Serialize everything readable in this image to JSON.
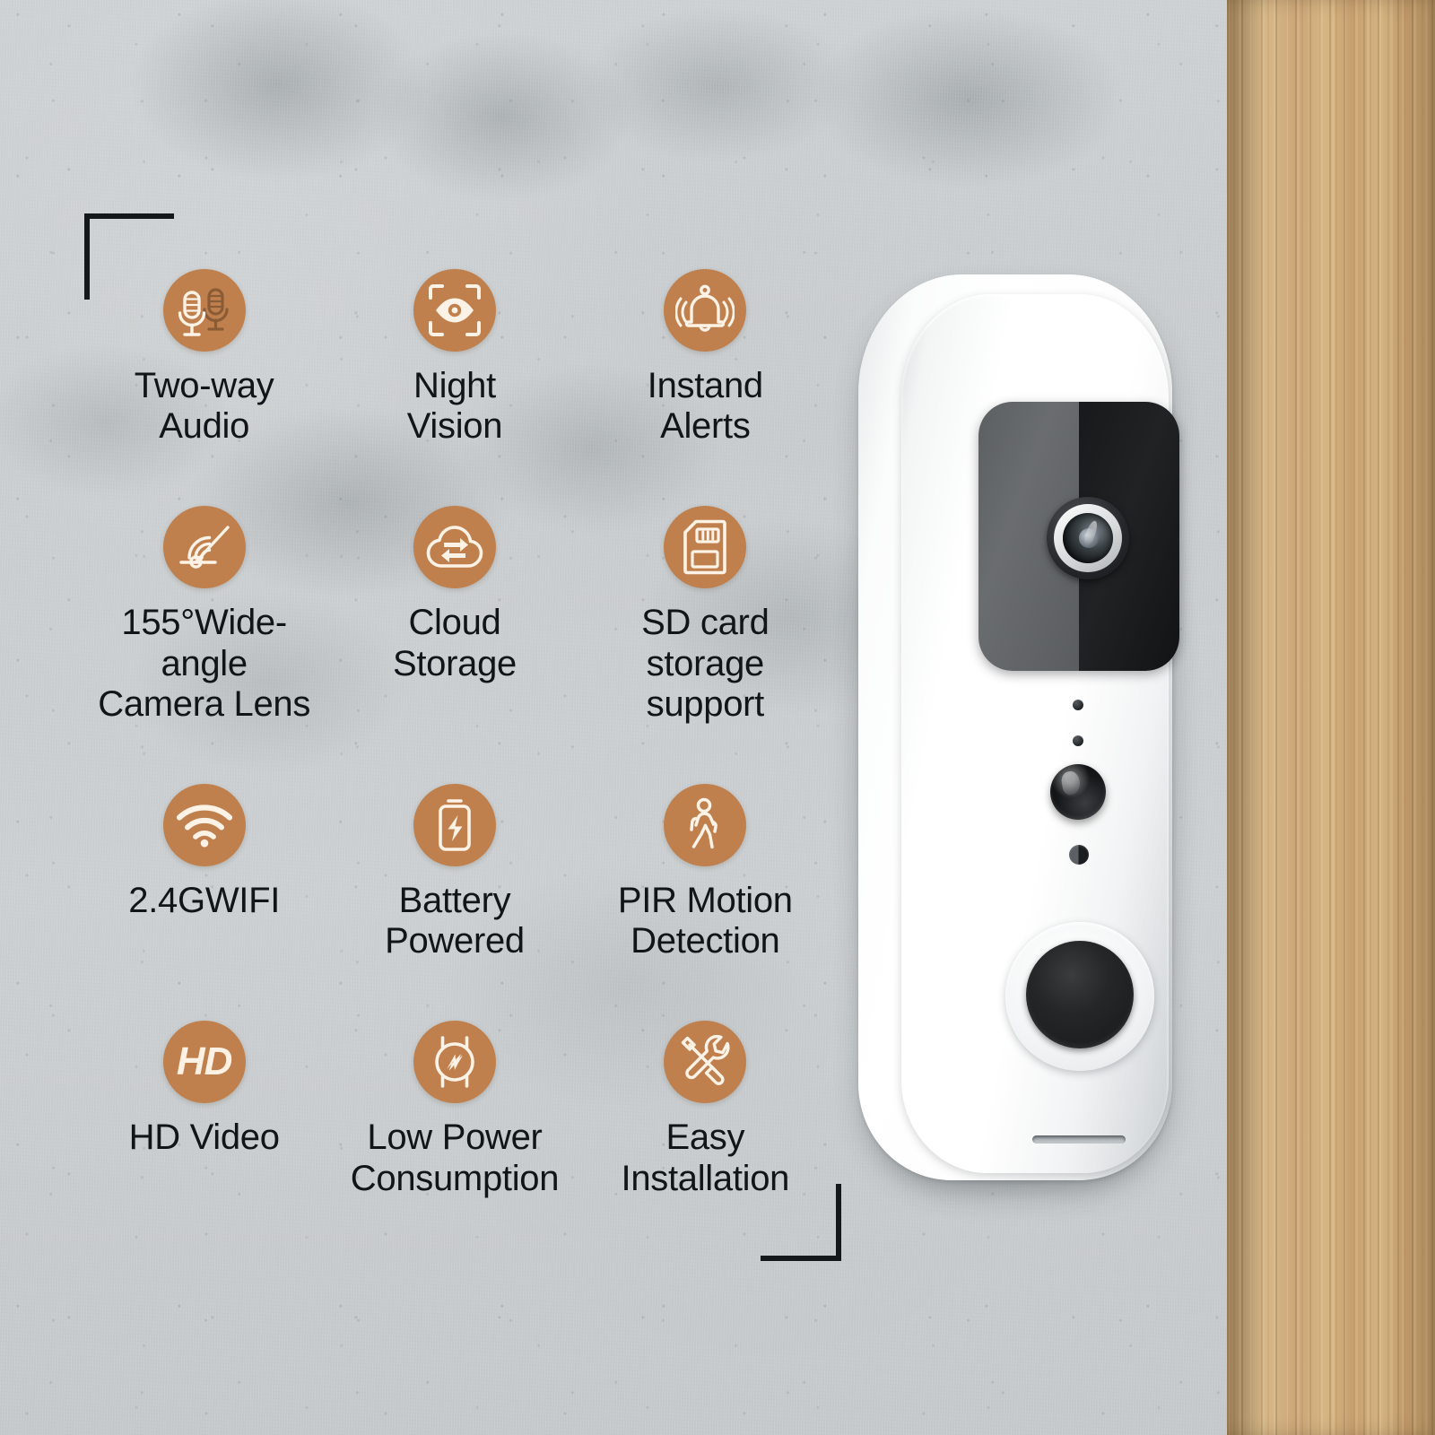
{
  "scene": {
    "title": "Smart Video Doorbell Feature Infographic",
    "background": "concrete-wall",
    "accent_color": "#c0804d",
    "text_color": "#111418",
    "wall_color": "#c9cdcf",
    "wood_color": "#cba577"
  },
  "brackets": {
    "top_left": "corner-bracket",
    "bottom_right": "corner-bracket"
  },
  "features": [
    {
      "icon": "two-way-audio-icon",
      "label": "Two-way\nAudio"
    },
    {
      "icon": "night-vision-eye-icon",
      "label": "Night\nVision"
    },
    {
      "icon": "instant-alerts-bell-icon",
      "label": "Instand\nAlerts"
    },
    {
      "icon": "wide-angle-lens-icon",
      "label": "155°Wide-angle\nCamera Lens"
    },
    {
      "icon": "cloud-storage-icon",
      "label": "Cloud\nStorage"
    },
    {
      "icon": "sd-card-icon",
      "label": "SD card\nstorage support"
    },
    {
      "icon": "wifi-icon",
      "label": "2.4GWIFI"
    },
    {
      "icon": "battery-icon",
      "label": "Battery\nPowered"
    },
    {
      "icon": "pir-motion-walking-icon",
      "label": "PIR Motion\nDetection"
    },
    {
      "icon": "hd-badge-icon",
      "label": "HD Video",
      "icon_text": "HD"
    },
    {
      "icon": "low-power-icon",
      "label": "Low Power\nConsumption"
    },
    {
      "icon": "easy-installation-tools-icon",
      "label": "Easy\nInstallation"
    }
  ],
  "product": {
    "name": "smart-video-doorbell",
    "parts": [
      "outer-housing",
      "camera-faceplate",
      "camera-lens",
      "microphone-dots",
      "pir-sensor-dome",
      "ambient-light-sensor",
      "doorbell-button",
      "speaker-slot"
    ]
  }
}
